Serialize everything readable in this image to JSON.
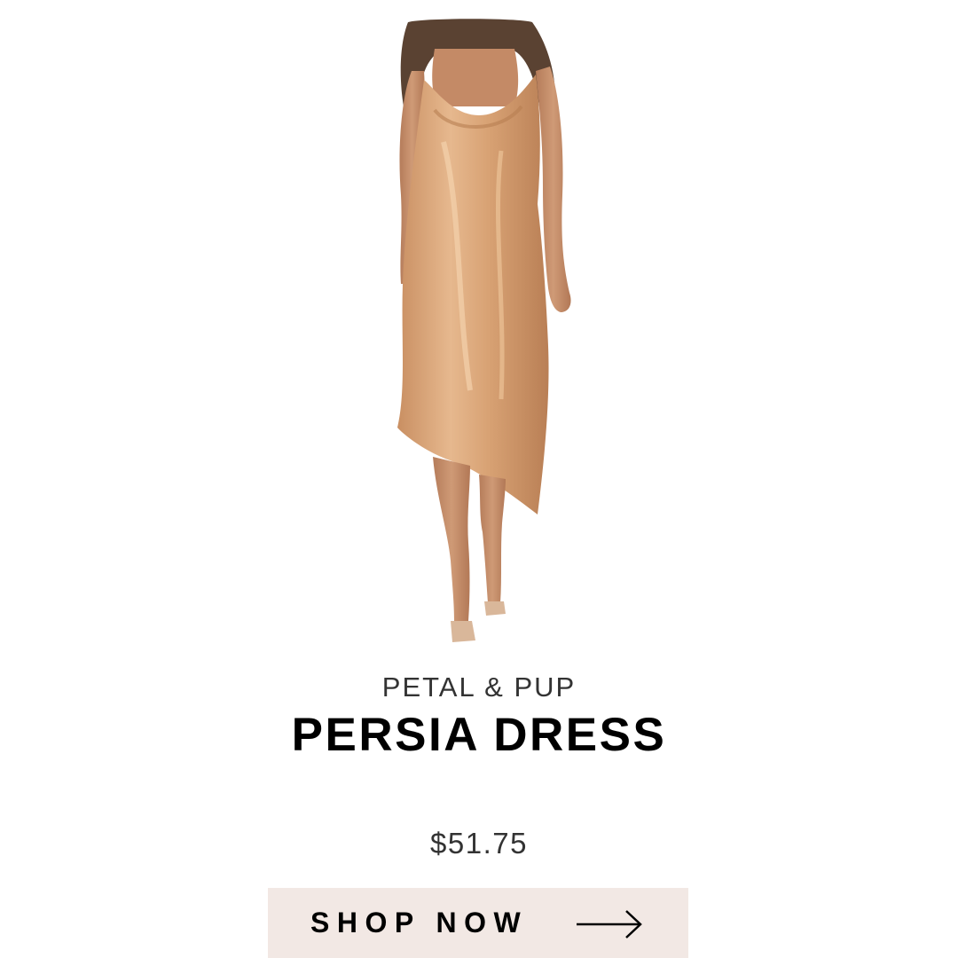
{
  "product": {
    "image_icon": "product-photo",
    "brand": "PETAL & PUP",
    "name": "PERSIA DRESS",
    "price": "$51.75"
  },
  "cta": {
    "label": "SHOP NOW",
    "icon": "arrow-right-icon",
    "background": "#f2e8e4"
  },
  "colors": {
    "dress": "#d9a678",
    "skin": "#c78e6a",
    "hair": "#5a4232",
    "text_primary": "#000000",
    "text_secondary": "#333333"
  }
}
